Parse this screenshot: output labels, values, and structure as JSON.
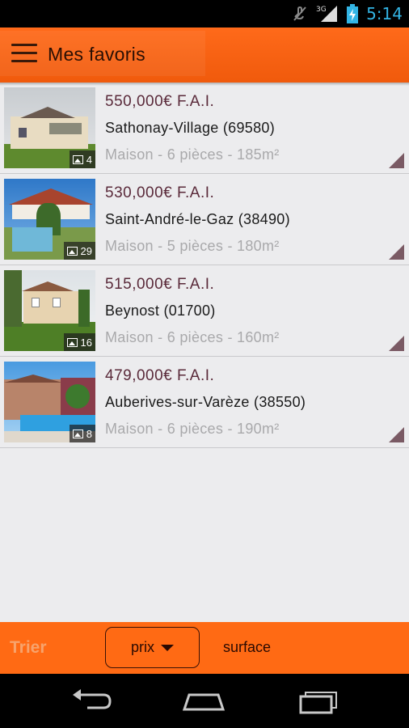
{
  "status_bar": {
    "time": "5:14",
    "network": "3G",
    "icons": [
      "mute-icon",
      "signal-3g-icon",
      "battery-charging-icon"
    ]
  },
  "header": {
    "title": "Mes favoris",
    "menu_icon": "hamburger-menu-icon"
  },
  "listings": [
    {
      "price": "550,000€ F.A.I.",
      "city": "Sathonay-Village (69580)",
      "details": "Maison - 6 pièces - 185m²",
      "photo_count": "4"
    },
    {
      "price": "530,000€ F.A.I.",
      "city": "Saint-André-le-Gaz (38490)",
      "details": "Maison - 5 pièces - 180m²",
      "photo_count": "29"
    },
    {
      "price": "515,000€ F.A.I.",
      "city": "Beynost (01700)",
      "details": "Maison - 6 pièces - 160m²",
      "photo_count": "16"
    },
    {
      "price": "479,000€ F.A.I.",
      "city": "Auberives-sur-Varèze (38550)",
      "details": "Maison - 6 pièces - 190m²",
      "photo_count": "8"
    }
  ],
  "sort_bar": {
    "label": "Trier",
    "options": [
      "prix",
      "surface"
    ],
    "selected": "prix"
  },
  "nav_bar": {
    "buttons": [
      "back-icon",
      "home-icon",
      "recent-apps-icon"
    ]
  },
  "colors": {
    "accent": "#ff6a14",
    "price_text": "#5a2a3a",
    "secondary_text": "#a9a9ab"
  }
}
